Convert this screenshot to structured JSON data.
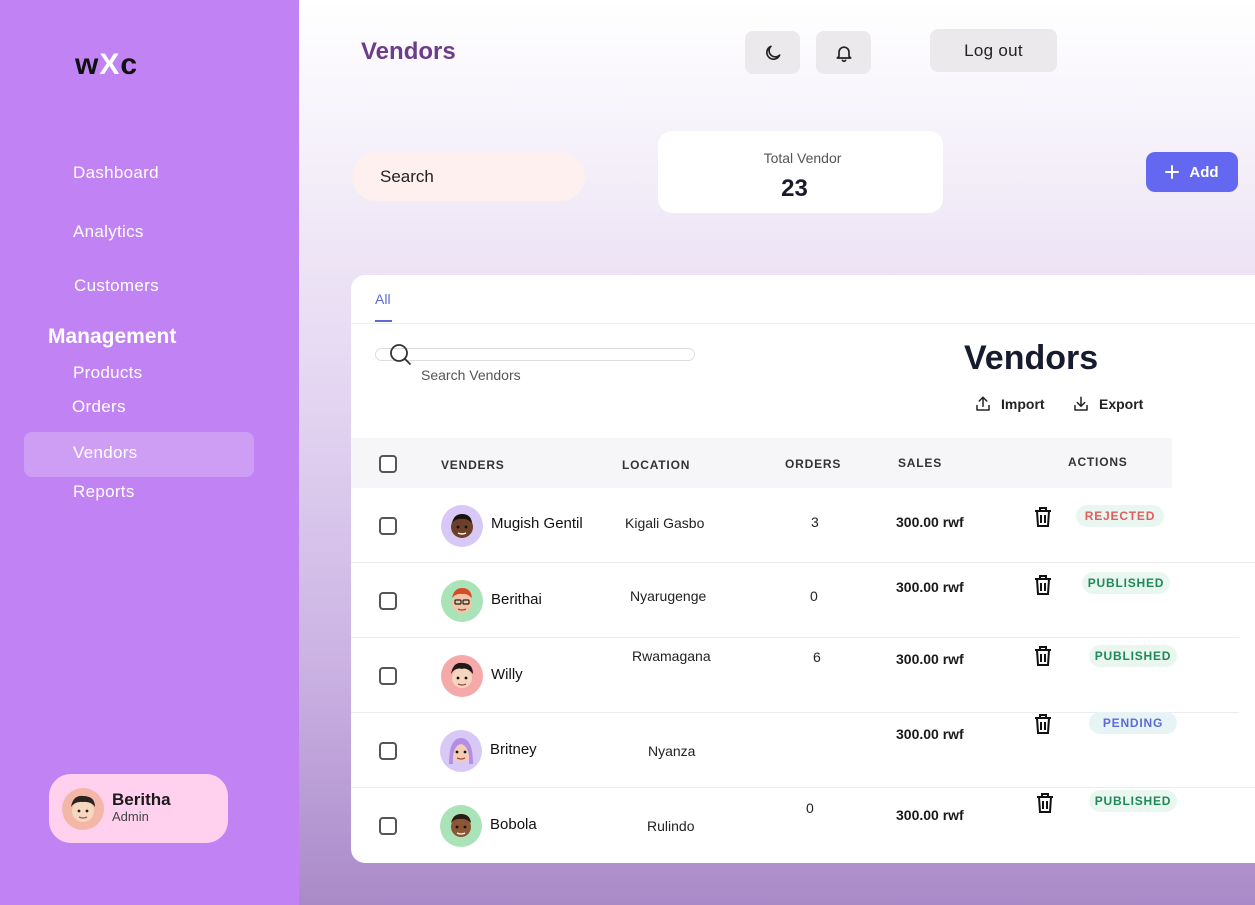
{
  "sidebar": {
    "logo_left": "w",
    "logo_mid": "X",
    "logo_right": "c",
    "nav": {
      "dashboard": "Dashboard",
      "analytics": "Analytics",
      "customers": "Customers",
      "section": "Management",
      "products": "Products",
      "orders": "Orders",
      "vendors": "Vendors",
      "reports": "Reports"
    },
    "user": {
      "name": "Beritha",
      "role": "Admin"
    }
  },
  "header": {
    "title": "Vendors",
    "theme_icon": "moon-icon",
    "notify_icon": "bell-icon",
    "logout_label": "Log out"
  },
  "toolbar": {
    "search_placeholder": "Search",
    "total_label": "Total Vendor",
    "total_value": "23",
    "add_label": "Add"
  },
  "panel": {
    "tab_all": "All",
    "search_placeholder": "Search Vendors",
    "title": "Vendors",
    "import_label": "Import",
    "export_label": "Export",
    "columns": {
      "vendors": "VENDERS",
      "location": "LOCATION",
      "orders": "ORDERS",
      "sales": "SALES",
      "actions": "ACTIONS"
    },
    "rows": [
      {
        "name": "Mugish Gentil",
        "location": "Kigali Gasbo",
        "orders": "3",
        "sales": "300.00 rwf",
        "status": "REJECTED"
      },
      {
        "name": "Berithai",
        "location": "Nyarugenge",
        "orders": "0",
        "sales": "300.00 rwf",
        "status": "PUBLISHED"
      },
      {
        "name": "Willy",
        "location": "Rwamagana",
        "orders": "6",
        "sales": "300.00 rwf",
        "status": "PUBLISHED"
      },
      {
        "name": "Britney",
        "location": "Nyanza",
        "orders": "",
        "sales": "300.00 rwf",
        "status": "PENDING"
      },
      {
        "name": "Bobola",
        "location": "Rulindo",
        "orders": "0",
        "sales": "300.00 rwf",
        "status": "PUBLISHED"
      }
    ]
  },
  "colors": {
    "sidebar": "#c183f3",
    "accent": "#6468f0",
    "rejected_text": "#e35d5d",
    "published_text": "#1e8a55",
    "pending_text": "#5c6bd6"
  }
}
